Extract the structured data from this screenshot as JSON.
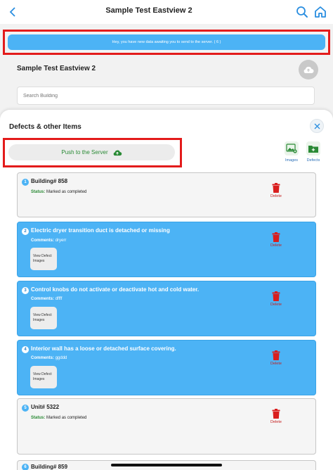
{
  "header": {
    "title": "Sample Test Eastview 2"
  },
  "banner": {
    "text": "Hey, you have new data awaiting you to send to the server. ( 6 )"
  },
  "project": {
    "name": "Sample Test Eastview 2",
    "search_placeholder": "Search Building"
  },
  "sheet": {
    "title": "Defects & other Items",
    "push_label": "Push to the Server",
    "images_label": "Images",
    "defects_label": "Defects"
  },
  "items": [
    {
      "number": "1",
      "title": "Building# 858",
      "status_key": "Status:",
      "status_value": "Marked as completed",
      "delete_label": "Delete"
    },
    {
      "number": "2",
      "title": "Electric dryer transition duct is detached or missing",
      "comments_key": "Comments:",
      "comments_value": "dryerr",
      "view_label": "View Defect Images",
      "delete_label": "Delete"
    },
    {
      "number": "3",
      "title": "Control knobs do not activate or deactivate hot and cold water.",
      "comments_key": "Comments:",
      "comments_value": "dffff",
      "view_label": "View Defect Images",
      "delete_label": "Delete"
    },
    {
      "number": "4",
      "title": "Interior wall has a loose or detached surface covering.",
      "comments_key": "Comments:",
      "comments_value": "ggddd",
      "view_label": "View Defect Images",
      "delete_label": "Delete"
    },
    {
      "number": "5",
      "title": "Unit# 5322",
      "status_key": "Status:",
      "status_value": "Marked as completed",
      "delete_label": "Delete"
    },
    {
      "number": "6",
      "title": "Building# 859"
    }
  ],
  "colors": {
    "accent": "#4cb3f5",
    "highlight_outline": "#e31b1b",
    "success": "#2a8a35",
    "delete": "#d91e1e"
  }
}
